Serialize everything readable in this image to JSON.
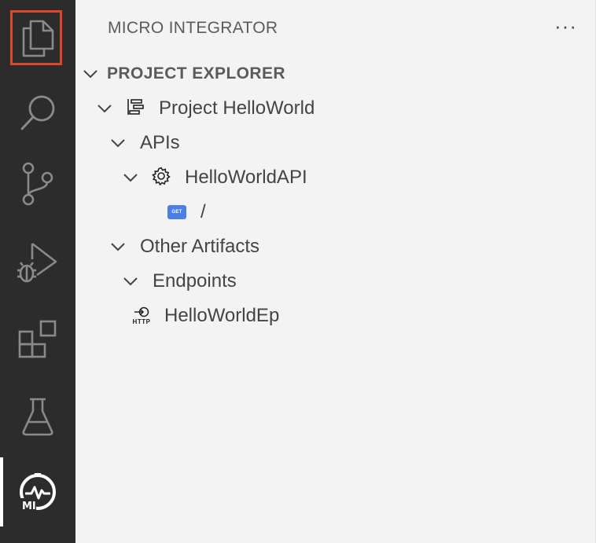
{
  "activity_bar": {
    "items": [
      {
        "name": "explorer",
        "icon": "files-icon",
        "selected": true
      },
      {
        "name": "search",
        "icon": "search-icon"
      },
      {
        "name": "source-control",
        "icon": "source-control-icon"
      },
      {
        "name": "run-debug",
        "icon": "run-debug-icon"
      },
      {
        "name": "extensions",
        "icon": "extensions-icon"
      },
      {
        "name": "testing",
        "icon": "beaker-icon"
      },
      {
        "name": "micro-integrator",
        "icon": "mi-logo-icon",
        "logo_text": "MI"
      }
    ],
    "colors": {
      "background": "#2c2c2c",
      "icon": "#8a8a8a",
      "highlight": "#e0452f"
    }
  },
  "panel": {
    "title": "MICRO INTEGRATOR",
    "more_actions": "···",
    "section": {
      "label": "PROJECT EXPLORER",
      "tree": [
        {
          "label": "Project HelloWorld",
          "icon": "project-icon",
          "expanded": true
        },
        {
          "label": "APIs",
          "expanded": true
        },
        {
          "label": "HelloWorldAPI",
          "icon": "gear-icon",
          "expanded": true
        },
        {
          "label": "/",
          "icon": "get-badge-icon",
          "badge": "GET"
        },
        {
          "label": "Other Artifacts",
          "expanded": true
        },
        {
          "label": "Endpoints",
          "expanded": true
        },
        {
          "label": "HelloWorldEp",
          "icon": "http-endpoint-icon",
          "badge": "HTTP"
        }
      ]
    }
  }
}
